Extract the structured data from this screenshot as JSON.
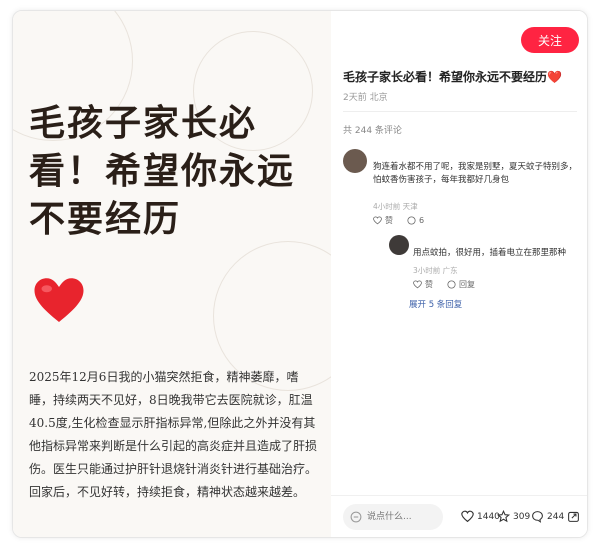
{
  "post": {
    "headline": "毛孩子家长必看！希望你永远不要经历",
    "body": "2025年12月6日我的小猫突然拒食，精神萎靡，嗜睡，持续两天不见好，8日晚我带它去医院就诊，肛温40.5度,生化检查显示肝指标异常,但除此之外并没有其他指标异常来判断是什么引起的高炎症并且造成了肝损伤。医生只能通过护肝针退烧针消炎针进行基础治疗。回家后，不见好转，持续拒食，精神状态越来越差。",
    "title": "毛孩子家长必看！希望你永远不要经历❤️",
    "meta": "2天前 北京",
    "comment_count": "共 244 条评论"
  },
  "header": {
    "follow_label": "关注"
  },
  "comments": [
    {
      "text": "狗连着水都不用了呢，我家是别墅，夏天蚊子特别多，怕蚊香伤害孩子，每年我都好几身包",
      "meta": "4小时前 天津",
      "likes": "赞",
      "replies": "6"
    },
    {
      "text": "用点蚊拍，很好用，插着电立在那里那种",
      "meta": "3小时前 广东",
      "likes": "赞",
      "replies": "回复"
    }
  ],
  "expand_label": "展开 5 条回复",
  "bottom": {
    "input_placeholder": "说点什么...",
    "likes": "1440",
    "stars": "309",
    "comments": "244"
  },
  "colors": {
    "accent": "#ff2442"
  }
}
